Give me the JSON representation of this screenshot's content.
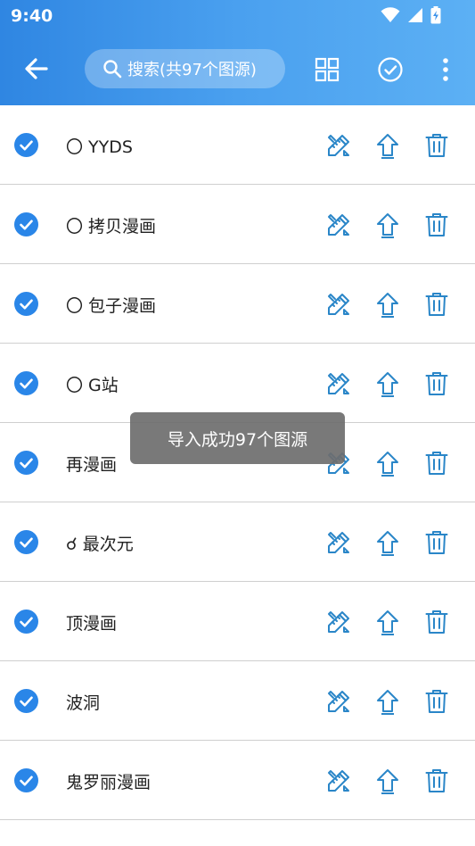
{
  "status_bar": {
    "time": "9:40",
    "icons": [
      "wifi-icon",
      "signal-icon",
      "battery-charging-icon"
    ]
  },
  "toolbar": {
    "search_placeholder": "搜索(共97个图源)",
    "icons": [
      "back-arrow-icon",
      "search-icon",
      "grid-icon",
      "check-circle-icon",
      "more-vert-icon"
    ]
  },
  "sources": [
    {
      "name": "〇 YYDS",
      "checked": true
    },
    {
      "name": "〇 拷贝漫画",
      "checked": true
    },
    {
      "name": "〇 包子漫画",
      "checked": true
    },
    {
      "name": "〇 G站",
      "checked": true
    },
    {
      "name": "再漫画",
      "checked": true
    },
    {
      "name": "☌ 最次元",
      "checked": true
    },
    {
      "name": "顶漫画",
      "checked": true
    },
    {
      "name": "波洞",
      "checked": true
    },
    {
      "name": "鬼罗丽漫画",
      "checked": true
    }
  ],
  "row_actions": [
    "edit-icon",
    "move-to-top-icon",
    "delete-icon"
  ],
  "toast": {
    "text": "导入成功97个图源"
  },
  "colors": {
    "accent": "#2f86e2",
    "check": "#2a86e8",
    "action_icon": "#2a86c8",
    "toast_bg": "#6e6e6e"
  }
}
